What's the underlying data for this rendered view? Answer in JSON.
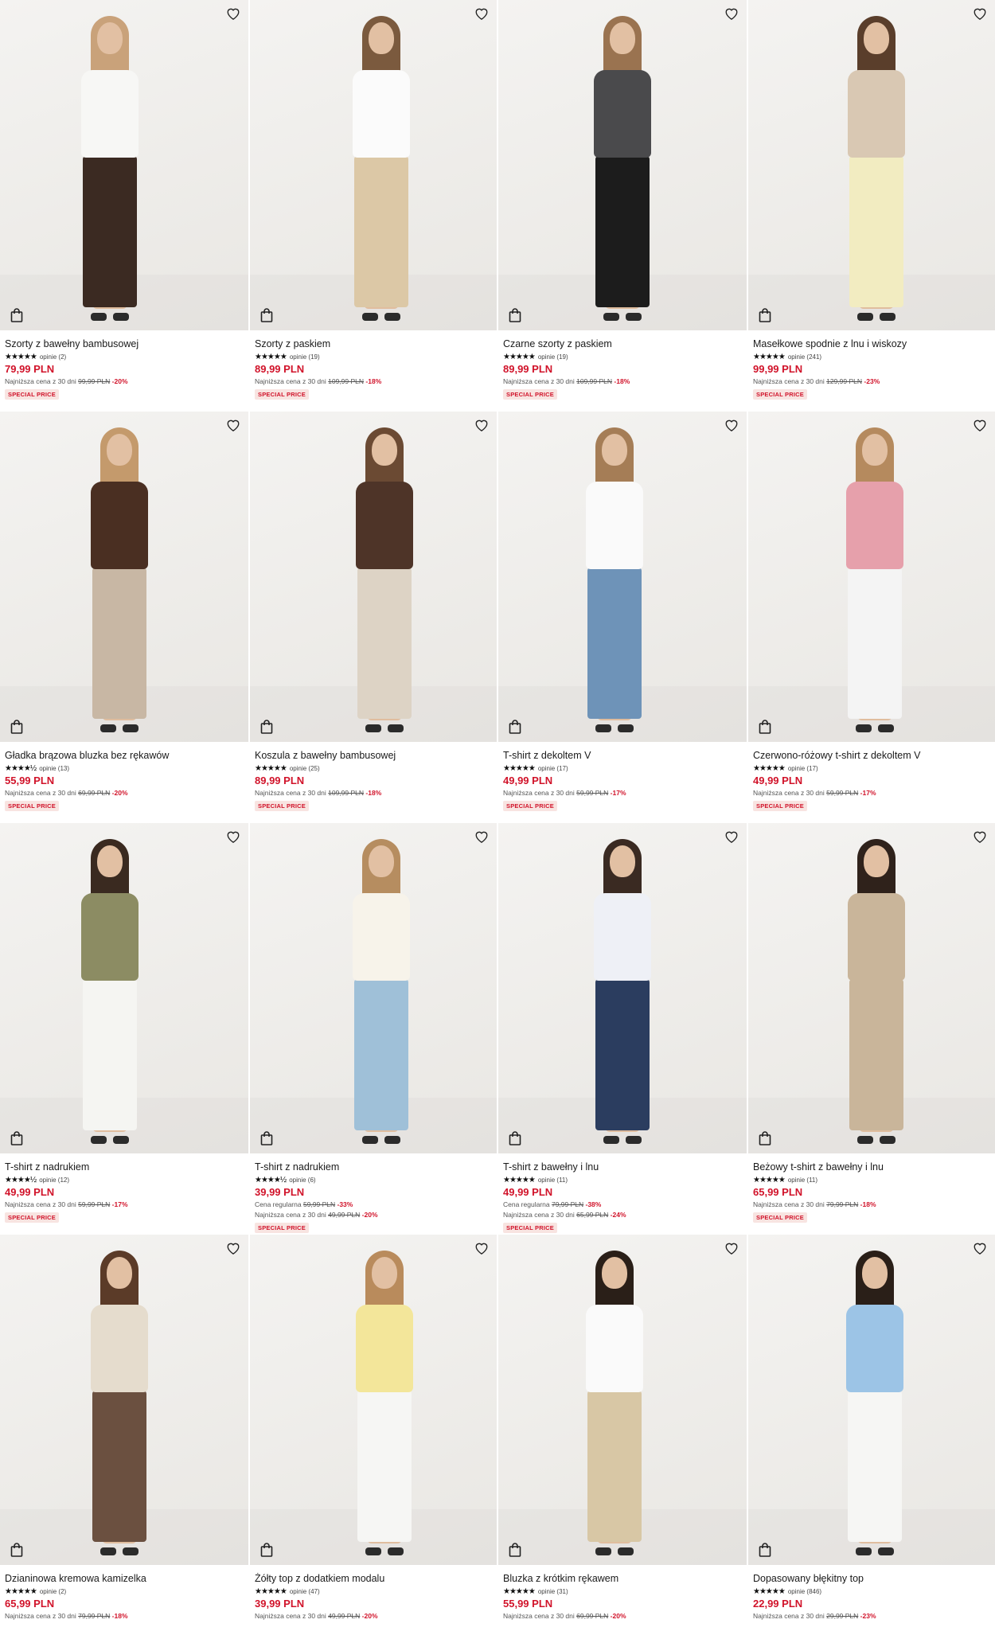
{
  "products": [
    {
      "name": "Szorty z bawełny bambusowej",
      "stars": "★★★★★",
      "reviews": "opinie (2)",
      "price": "79,99 PLN",
      "meta": [
        {
          "prefix": "Najniższa cena z 30 dni",
          "old": "99,99 PLN",
          "disc": "-20%"
        }
      ],
      "badge": "SPECIAL PRICE",
      "colors": {
        "hair": "#c9a27a",
        "top": "#f7f7f5",
        "bottom": "#3b2a22",
        "jacket": "#e8dcc8"
      }
    },
    {
      "name": "Szorty z paskiem",
      "stars": "★★★★★",
      "reviews": "opinie (19)",
      "price": "89,99 PLN",
      "meta": [
        {
          "prefix": "Najniższa cena z 30 dni",
          "old": "109,99 PLN",
          "disc": "-18%"
        }
      ],
      "badge": "SPECIAL PRICE",
      "colors": {
        "hair": "#7b5a3e",
        "top": "#fbfbfb",
        "bottom": "#dcc8a6",
        "jacket": "#fbfbfb"
      }
    },
    {
      "name": "Czarne szorty z paskiem",
      "stars": "★★★★★",
      "reviews": "opinie (19)",
      "price": "89,99 PLN",
      "meta": [
        {
          "prefix": "Najniższa cena z 30 dni",
          "old": "109,99 PLN",
          "disc": "-18%"
        }
      ],
      "badge": "SPECIAL PRICE",
      "colors": {
        "hair": "#9a7350",
        "top": "#4a4a4c",
        "bottom": "#1c1c1c",
        "jacket": "#4a4a4c"
      }
    },
    {
      "name": "Masełkowe spodnie z lnu i wiskozy",
      "stars": "★★★★★",
      "reviews": "opinie (241)",
      "price": "99,99 PLN",
      "meta": [
        {
          "prefix": "Najniższa cena z 30 dni",
          "old": "129,99 PLN",
          "disc": "-23%"
        }
      ],
      "badge": "SPECIAL PRICE",
      "colors": {
        "hair": "#5a3e2b",
        "top": "#d9c8b3",
        "bottom": "#f2ecc1",
        "jacket": "#d9c8b3"
      }
    },
    {
      "name": "Gładka brązowa bluzka bez rękawów",
      "stars": "★★★★½",
      "reviews": "opinie (13)",
      "price": "55,99 PLN",
      "meta": [
        {
          "prefix": "Najniższa cena z 30 dni",
          "old": "69,99 PLN",
          "disc": "-20%"
        }
      ],
      "badge": "SPECIAL PRICE",
      "colors": {
        "hair": "#c49a6c",
        "top": "#4a2f22",
        "bottom": "#c8b7a4",
        "jacket": "#4a2f22"
      }
    },
    {
      "name": "Koszula z bawełny bambusowej",
      "stars": "★★★★★",
      "reviews": "opinie (25)",
      "price": "89,99 PLN",
      "meta": [
        {
          "prefix": "Najniższa cena z 30 dni",
          "old": "109,99 PLN",
          "disc": "-18%"
        }
      ],
      "badge": "SPECIAL PRICE",
      "colors": {
        "hair": "#6b4a33",
        "top": "#4e3428",
        "bottom": "#ddd3c5",
        "jacket": "#4e3428"
      }
    },
    {
      "name": "T-shirt z dekoltem V",
      "stars": "★★★★★",
      "reviews": "opinie (17)",
      "price": "49,99 PLN",
      "meta": [
        {
          "prefix": "Najniższa cena z 30 dni",
          "old": "59,99 PLN",
          "disc": "-17%"
        }
      ],
      "badge": "SPECIAL PRICE",
      "colors": {
        "hair": "#a57d56",
        "top": "#fafafa",
        "bottom": "#6e93b8",
        "jacket": "#fafafa"
      }
    },
    {
      "name": "Czerwono-różowy t-shirt z dekoltem V",
      "stars": "★★★★★",
      "reviews": "opinie (17)",
      "price": "49,99 PLN",
      "meta": [
        {
          "prefix": "Najniższa cena z 30 dni",
          "old": "59,99 PLN",
          "disc": "-17%"
        }
      ],
      "badge": "SPECIAL PRICE",
      "colors": {
        "hair": "#b58a5e",
        "top": "#e6a0ab",
        "bottom": "#f4f4f4",
        "jacket": "#e6a0ab"
      }
    },
    {
      "name": "T-shirt z nadrukiem",
      "stars": "★★★★½",
      "reviews": "opinie (12)",
      "price": "49,99 PLN",
      "meta": [
        {
          "prefix": "Najniższa cena z 30 dni",
          "old": "59,99 PLN",
          "disc": "-17%"
        }
      ],
      "badge": "SPECIAL PRICE",
      "colors": {
        "hair": "#3a2a20",
        "top": "#8c8c63",
        "bottom": "#f5f5f2",
        "jacket": "#8c8c63"
      }
    },
    {
      "name": "T-shirt z nadrukiem",
      "stars": "★★★★½",
      "reviews": "opinie (6)",
      "price": "39,99 PLN",
      "meta": [
        {
          "prefix": "Cena regularna",
          "old": "59,99 PLN",
          "disc": "-33%"
        },
        {
          "prefix": "Najniższa cena z 30 dni",
          "old": "49,99 PLN",
          "disc": "-20%"
        }
      ],
      "badge": "SPECIAL PRICE",
      "colors": {
        "hair": "#b68d60",
        "top": "#f7f3ea",
        "bottom": "#9fc0d8",
        "jacket": "#f7f3ea"
      }
    },
    {
      "name": "T-shirt z bawełny i lnu",
      "stars": "★★★★★",
      "reviews": "opinie (11)",
      "price": "49,99 PLN",
      "meta": [
        {
          "prefix": "Cena regularna",
          "old": "79,99 PLN",
          "disc": "-38%"
        },
        {
          "prefix": "Najniższa cena z 30 dni",
          "old": "65,99 PLN",
          "disc": "-24%"
        }
      ],
      "badge": "SPECIAL PRICE",
      "colors": {
        "hair": "#3a2a22",
        "top": "#eef0f6",
        "bottom": "#2b3d5f",
        "jacket": "#eef0f6"
      }
    },
    {
      "name": "Beżowy t-shirt z bawełny i lnu",
      "stars": "★★★★★",
      "reviews": "opinie (11)",
      "price": "65,99 PLN",
      "meta": [
        {
          "prefix": "Najniższa cena z 30 dni",
          "old": "79,99 PLN",
          "disc": "-18%"
        }
      ],
      "badge": "SPECIAL PRICE",
      "colors": {
        "hair": "#2f221b",
        "top": "#c9b59a",
        "bottom": "#c9b59a",
        "jacket": "#c9b59a"
      }
    },
    {
      "name": "Dzianinowa kremowa kamizelka",
      "stars": "★★★★★",
      "reviews": "opinie (2)",
      "price": "65,99 PLN",
      "meta": [
        {
          "prefix": "Najniższa cena z 30 dni",
          "old": "79,99 PLN",
          "disc": "-18%"
        }
      ],
      "badge": "",
      "colors": {
        "hair": "#5b3b28",
        "top": "#e5dccd",
        "bottom": "#6b5040",
        "jacket": "#e5dccd"
      }
    },
    {
      "name": "Żółty top z dodatkiem modalu",
      "stars": "★★★★★",
      "reviews": "opinie (47)",
      "price": "39,99 PLN",
      "meta": [
        {
          "prefix": "Najniższa cena z 30 dni",
          "old": "49,99 PLN",
          "disc": "-20%"
        }
      ],
      "badge": "",
      "colors": {
        "hair": "#b98b5c",
        "top": "#f3e69a",
        "bottom": "#f6f6f4",
        "jacket": "#f3e69a"
      }
    },
    {
      "name": "Bluzka z krótkim rękawem",
      "stars": "★★★★★",
      "reviews": "opinie (31)",
      "price": "55,99 PLN",
      "meta": [
        {
          "prefix": "Najniższa cena z 30 dni",
          "old": "69,99 PLN",
          "disc": "-20%"
        }
      ],
      "badge": "",
      "colors": {
        "hair": "#2a1f18",
        "top": "#fafafa",
        "bottom": "#d8c7a5",
        "jacket": "#fafafa"
      }
    },
    {
      "name": "Dopasowany błękitny top",
      "stars": "★★★★★",
      "reviews": "opinie (846)",
      "price": "22,99 PLN",
      "meta": [
        {
          "prefix": "Najniższa cena z 30 dni",
          "old": "29,99 PLN",
          "disc": "-23%"
        }
      ],
      "badge": "",
      "colors": {
        "hair": "#2a1f18",
        "top": "#9cc4e6",
        "bottom": "#f6f6f4",
        "jacket": "#9cc4e6"
      }
    }
  ],
  "icons": {
    "wishlist": "heart-outline-icon",
    "cart": "shopping-bag-icon"
  },
  "accent_color": "#d1132a"
}
